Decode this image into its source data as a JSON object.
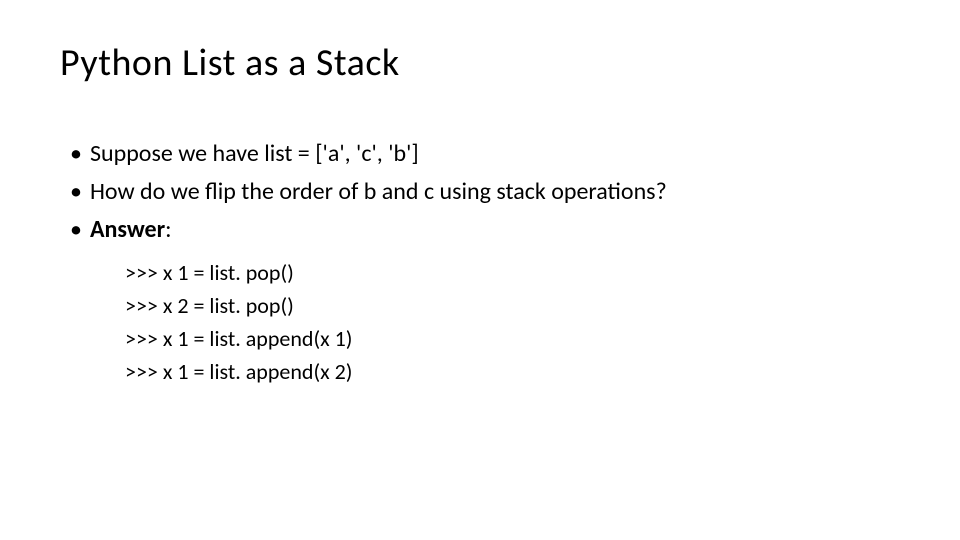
{
  "title": "Python List as a Stack",
  "bullets": {
    "b1": "Suppose we have  list = ['a', 'c', 'b']",
    "b2": "How do we flip the order of b and c using stack operations?",
    "b3_label": "Answer",
    "b3_colon": ":"
  },
  "code": {
    "l1": ">>> x 1 = list. pop()",
    "l2": ">>> x 2 = list. pop()",
    "l3": ">>> x 1 = list. append(x 1)",
    "l4": ">>> x 1 = list. append(x 2)"
  }
}
